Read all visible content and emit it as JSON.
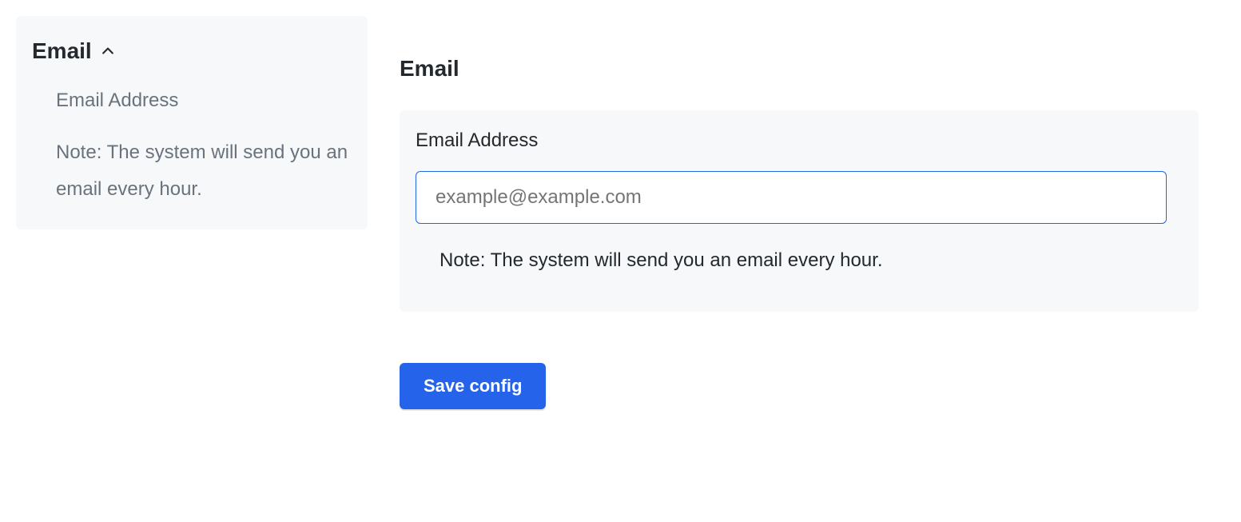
{
  "sidebar": {
    "group_title": "Email",
    "items": [
      {
        "label": "Email Address"
      }
    ],
    "note": "Note: The system will send you an email every hour."
  },
  "main": {
    "section_title": "Email",
    "field_label": "Email Address",
    "email_placeholder": "example@example.com",
    "email_value": "",
    "note": "Note: The system will send you an email every hour.",
    "save_label": "Save config"
  }
}
